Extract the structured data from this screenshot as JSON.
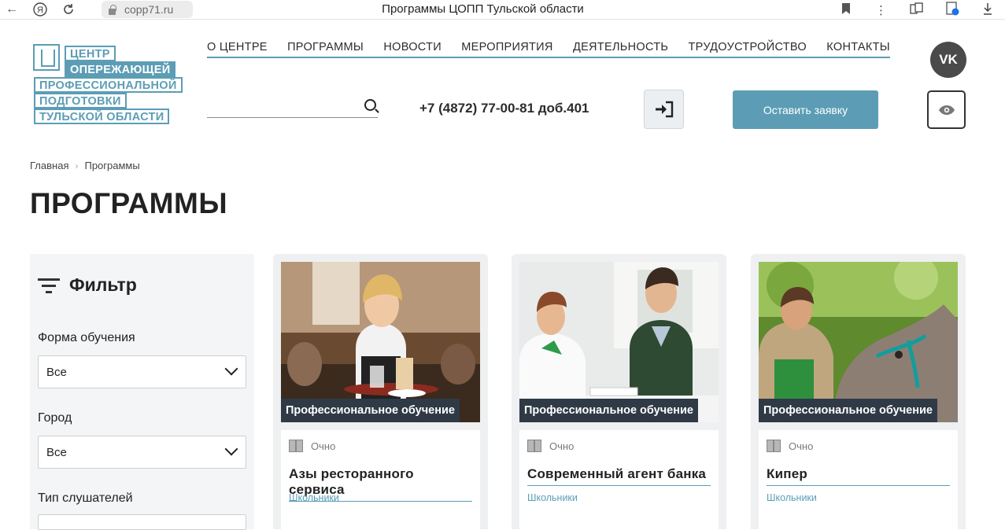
{
  "browser": {
    "url": "copp71.ru",
    "tab_title": "Программы ЦОПП Тульской области"
  },
  "logo": {
    "lines": [
      "ЦЕНТР",
      "ОПЕРЕЖАЮЩЕЙ",
      "ПРОФЕССИОНАЛЬНОЙ",
      "ПОДГОТОВКИ",
      "ТУЛЬСКОЙ ОБЛАСТИ"
    ]
  },
  "nav": {
    "items": [
      "О ЦЕНТРЕ",
      "ПРОГРАММЫ",
      "НОВОСТИ",
      "МЕРОПРИЯТИЯ",
      "ДЕЯТЕЛЬНОСТЬ",
      "ТРУДОУСТРОЙСТВО",
      "КОНТАКТЫ"
    ]
  },
  "header": {
    "phone": "+7 (4872) 77-00-81 доб.401",
    "apply_label": "Оставить заявку",
    "vk_label": "VK"
  },
  "breadcrumb": {
    "home": "Главная",
    "current": "Программы"
  },
  "page": {
    "title": "ПРОГРАММЫ"
  },
  "filter": {
    "title": "Фильтр",
    "study_form_label": "Форма обучения",
    "study_form_value": "Все",
    "city_label": "Город",
    "city_value": "Все",
    "audience_label": "Тип слушателей"
  },
  "cards": [
    {
      "badge": "Профессиональное обучение",
      "mode": "Очно",
      "title": "Азы ресторанного сервиса",
      "audience": "Школьники"
    },
    {
      "badge": "Профессиональное обучение",
      "mode": "Очно",
      "title": "Современный агент банка",
      "audience": "Школьники"
    },
    {
      "badge": "Профессиональное обучение",
      "mode": "Очно",
      "title": "Кипер",
      "audience": "Школьники"
    }
  ],
  "colors": {
    "accent": "#5c9db5",
    "badge_bg": "#2f3a46",
    "vk_bg": "#4a4a4a"
  }
}
